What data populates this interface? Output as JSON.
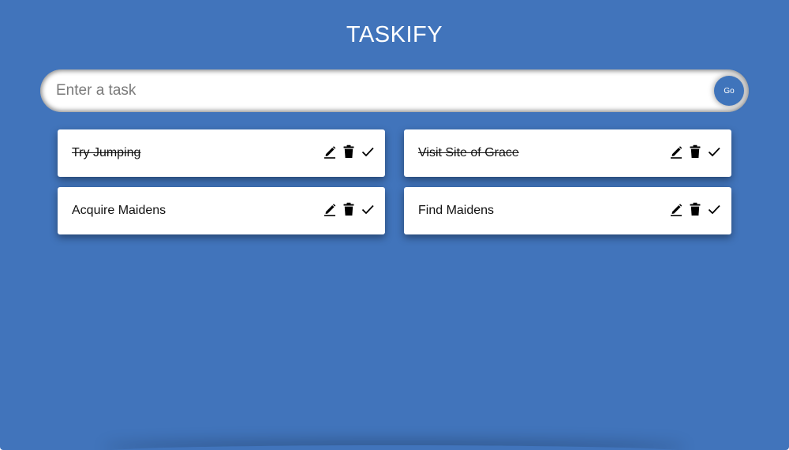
{
  "app": {
    "title": "TASKIFY"
  },
  "input": {
    "placeholder": "Enter a task",
    "value": "",
    "submit_label": "Go"
  },
  "todos": [
    {
      "text": "Try Jumping",
      "done": true
    },
    {
      "text": "Visit Site of Grace",
      "done": true
    },
    {
      "text": "Acquire Maidens",
      "done": false
    },
    {
      "text": "Find Maidens",
      "done": false
    }
  ],
  "icons": {
    "edit": "pencil-icon",
    "delete": "trash-icon",
    "complete": "check-icon"
  },
  "colors": {
    "background": "#4174bb",
    "card": "#ffffff",
    "go_button": "#3f74bb"
  }
}
